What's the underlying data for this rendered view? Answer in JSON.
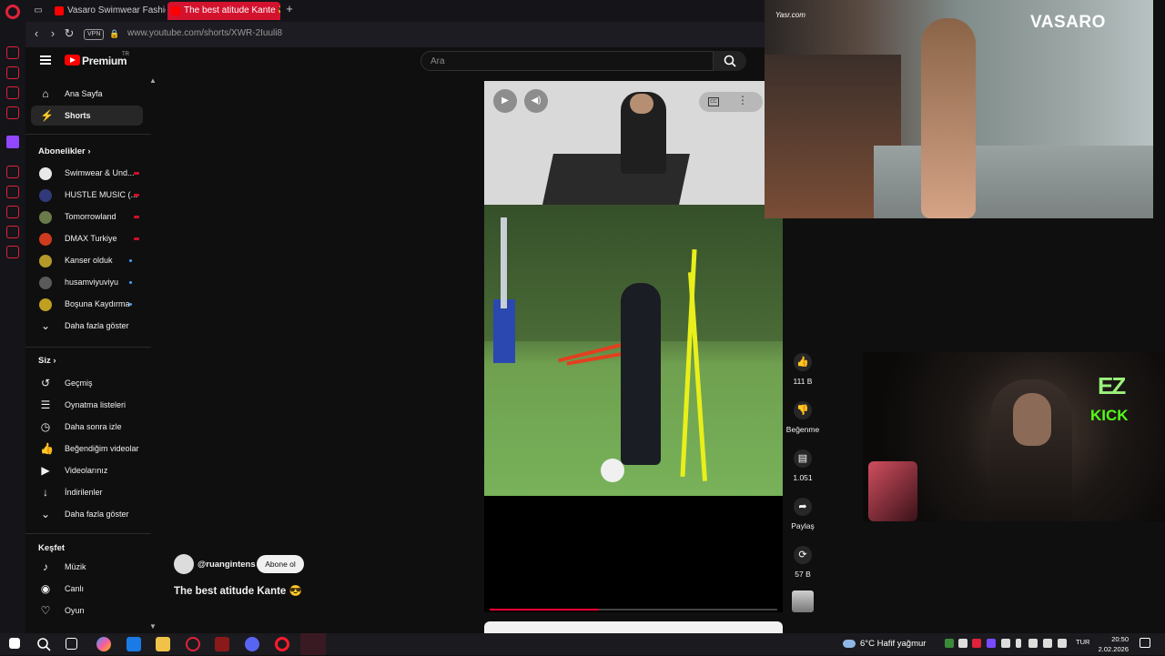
{
  "browser": {
    "tabs": [
      {
        "label": "Vasaro Swimwear Fashion",
        "active": false
      },
      {
        "label": "The best atitude Kante 😎",
        "active": true
      }
    ],
    "new_tab": "+",
    "vpn": "VPN",
    "url": "www.youtube.com/shorts/XWR-2Iuuli8"
  },
  "youtube": {
    "brand": "Premium",
    "country": "TR",
    "search_placeholder": "Ara",
    "nav_main": [
      {
        "label": "Ana Sayfa",
        "icon": "home-icon",
        "glyph": "⌂"
      },
      {
        "label": "Shorts",
        "icon": "shorts-icon",
        "glyph": "⚡",
        "selected": true
      }
    ],
    "subscriptions_title": "Abonelikler",
    "subscriptions": [
      {
        "label": "Swimwear & Und...",
        "status": "live",
        "color": "#e8e8e8"
      },
      {
        "label": "HUSTLE MUSIC (...",
        "status": "live",
        "color": "#303a7a"
      },
      {
        "label": "Tomorrowland",
        "status": "live",
        "color": "#6a7a4a"
      },
      {
        "label": "DMAX Turkiye",
        "status": "live",
        "color": "#d03a1e"
      },
      {
        "label": "Kanser olduk",
        "status": "new",
        "color": "#b59a2a"
      },
      {
        "label": "husamviyuviyu",
        "status": "new",
        "color": "#5a5a5a"
      },
      {
        "label": "Boşuna Kaydırma",
        "status": "new",
        "color": "#c0a020"
      }
    ],
    "subscriptions_more": "Daha fazla göster",
    "you_title": "Siz",
    "you_items": [
      {
        "label": "Geçmiş",
        "icon": "history-icon",
        "glyph": "↺"
      },
      {
        "label": "Oynatma listeleri",
        "icon": "playlists-icon",
        "glyph": "☰"
      },
      {
        "label": "Daha sonra izle",
        "icon": "watch-later-icon",
        "glyph": "◷"
      },
      {
        "label": "Beğendiğim videolar",
        "icon": "liked-videos-icon",
        "glyph": "👍"
      },
      {
        "label": "Videolarınız",
        "icon": "your-videos-icon",
        "glyph": "▶"
      },
      {
        "label": "İndirilenler",
        "icon": "downloads-icon",
        "glyph": "↓"
      }
    ],
    "you_more": "Daha fazla göster",
    "explore_title": "Keşfet",
    "explore_items": [
      {
        "label": "Müzik",
        "icon": "music-icon",
        "glyph": "♪"
      },
      {
        "label": "Canlı",
        "icon": "live-icon",
        "glyph": "◉"
      },
      {
        "label": "Oyun",
        "icon": "gaming-icon",
        "glyph": "♡"
      }
    ]
  },
  "short": {
    "channel": "@ruangintens",
    "subscribe": "Abone ol",
    "title": "The best atitude Kante 😎",
    "progress": 0.38,
    "actions": [
      {
        "name": "like",
        "glyph": "👍",
        "label": "111 B"
      },
      {
        "name": "dislike",
        "glyph": "👎",
        "label": "Beğenme"
      },
      {
        "name": "comments",
        "glyph": "▤",
        "label": "1.051"
      },
      {
        "name": "share",
        "glyph": "➦",
        "label": "Paylaş"
      },
      {
        "name": "remix",
        "glyph": "⟳",
        "label": "57 B"
      }
    ]
  },
  "overlay": {
    "brand": "VASARO",
    "brand_small": "Yasr.com",
    "ez": "EZ",
    "kick": "KICK"
  },
  "taskbar": {
    "weather": "6°C  Hafif yağmur",
    "lang": "TUR",
    "time": "20:50",
    "date": "2.02.2026"
  },
  "colors": {
    "accent": "#ff0000",
    "opera": "#e0223a",
    "active_tab": "#d3122e"
  }
}
